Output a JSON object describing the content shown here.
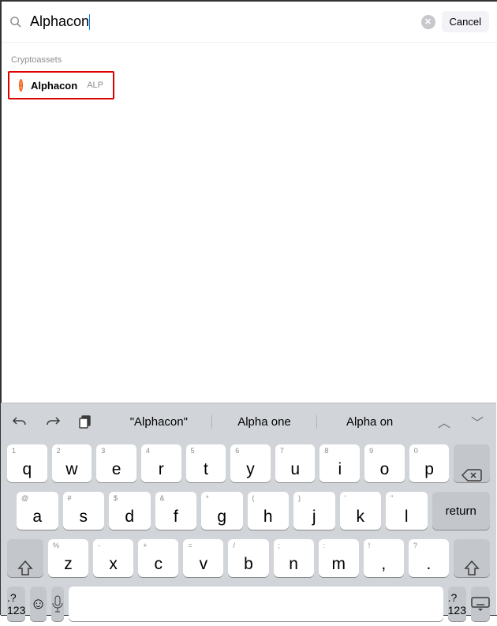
{
  "search": {
    "value": "Alphacon",
    "cancel": "Cancel"
  },
  "section": {
    "label": "Cryptoassets"
  },
  "result": {
    "name": "Alphacon",
    "symbol": "ALP"
  },
  "suggestions": {
    "s1": "\"Alphacon\"",
    "s2": "Alpha one",
    "s3": "Alpha on"
  },
  "keys": {
    "r1": [
      {
        "s": "1",
        "m": "q"
      },
      {
        "s": "2",
        "m": "w"
      },
      {
        "s": "3",
        "m": "e"
      },
      {
        "s": "4",
        "m": "r"
      },
      {
        "s": "5",
        "m": "t"
      },
      {
        "s": "6",
        "m": "y"
      },
      {
        "s": "7",
        "m": "u"
      },
      {
        "s": "8",
        "m": "i"
      },
      {
        "s": "9",
        "m": "o"
      },
      {
        "s": "0",
        "m": "p"
      }
    ],
    "r2": [
      {
        "s": "@",
        "m": "a"
      },
      {
        "s": "#",
        "m": "s"
      },
      {
        "s": "$",
        "m": "d"
      },
      {
        "s": "&",
        "m": "f"
      },
      {
        "s": "*",
        "m": "g"
      },
      {
        "s": "(",
        "m": "h"
      },
      {
        "s": ")",
        "m": "j"
      },
      {
        "s": "'",
        "m": "k"
      },
      {
        "s": "\"",
        "m": "l"
      }
    ],
    "r3": [
      {
        "s": "%",
        "m": "z"
      },
      {
        "s": "-",
        "m": "x"
      },
      {
        "s": "+",
        "m": "c"
      },
      {
        "s": "=",
        "m": "v"
      },
      {
        "s": "/",
        "m": "b"
      },
      {
        "s": ";",
        "m": "n"
      },
      {
        "s": ":",
        "m": "m"
      },
      {
        "s": "!",
        "m": ","
      },
      {
        "s": "?",
        "m": "."
      }
    ],
    "return": "return",
    "numMode": ".?123"
  }
}
